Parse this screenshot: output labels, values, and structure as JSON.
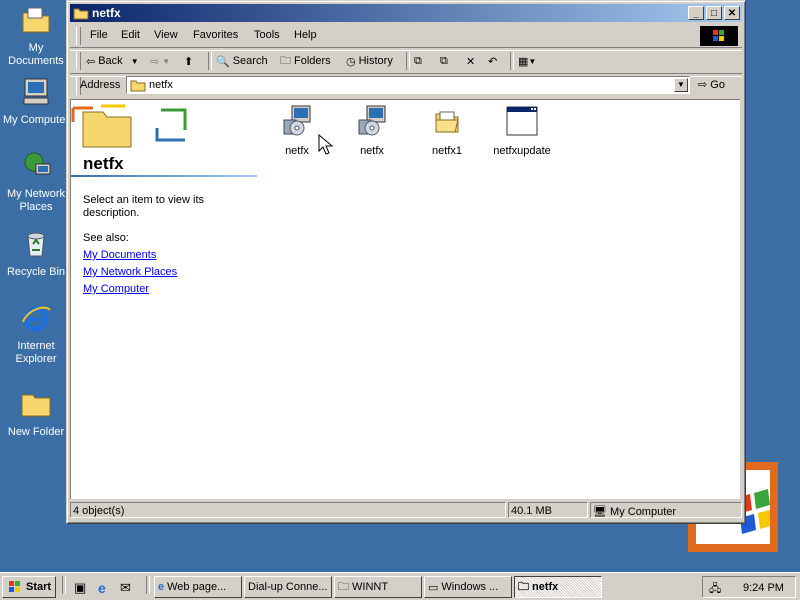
{
  "desktop": {
    "icons": [
      {
        "label": "My Documents",
        "icon": "folder-documents-icon"
      },
      {
        "label": "My Computer",
        "icon": "computer-icon"
      },
      {
        "label": "My Network Places",
        "icon": "network-icon"
      },
      {
        "label": "Recycle Bin",
        "icon": "recycle-bin-icon"
      },
      {
        "label": "Internet Explorer",
        "icon": "ie-icon"
      },
      {
        "label": "New Folder",
        "icon": "folder-icon"
      }
    ]
  },
  "window": {
    "title": "netfx",
    "menu": [
      "File",
      "Edit",
      "View",
      "Favorites",
      "Tools",
      "Help"
    ],
    "toolbar": {
      "back": "Back",
      "search": "Search",
      "folders": "Folders",
      "history": "History"
    },
    "address": {
      "label": "Address",
      "value": "netfx",
      "go": "Go"
    },
    "left_pane": {
      "title": "netfx",
      "description": "Select an item to view its description.",
      "see_also": "See also:",
      "links": [
        "My Documents",
        "My Network Places",
        "My Computer"
      ]
    },
    "files": [
      {
        "name": "netfx",
        "icon": "installer-icon"
      },
      {
        "name": "netfx",
        "icon": "installer-icon"
      },
      {
        "name": "netfx1",
        "icon": "open-folder-icon"
      },
      {
        "name": "netfxupdate",
        "icon": "window-app-icon"
      }
    ],
    "status": {
      "objects": "4 object(s)",
      "size": "40.1 MB",
      "zone": "My Computer"
    }
  },
  "taskbar": {
    "start": "Start",
    "tasks": [
      {
        "label": "Web page...",
        "active": false
      },
      {
        "label": "Dial-up Conne...",
        "active": false
      },
      {
        "label": "WINNT",
        "active": false
      },
      {
        "label": "Windows ...",
        "active": false
      },
      {
        "label": "netfx",
        "active": true
      }
    ],
    "clock": "9:24 PM"
  },
  "colors": {
    "desktop": "#3a6ea5",
    "titlebar_start": "#0a246a",
    "titlebar_end": "#a6caf0",
    "face": "#d4d0c8",
    "link": "#0000ff"
  }
}
